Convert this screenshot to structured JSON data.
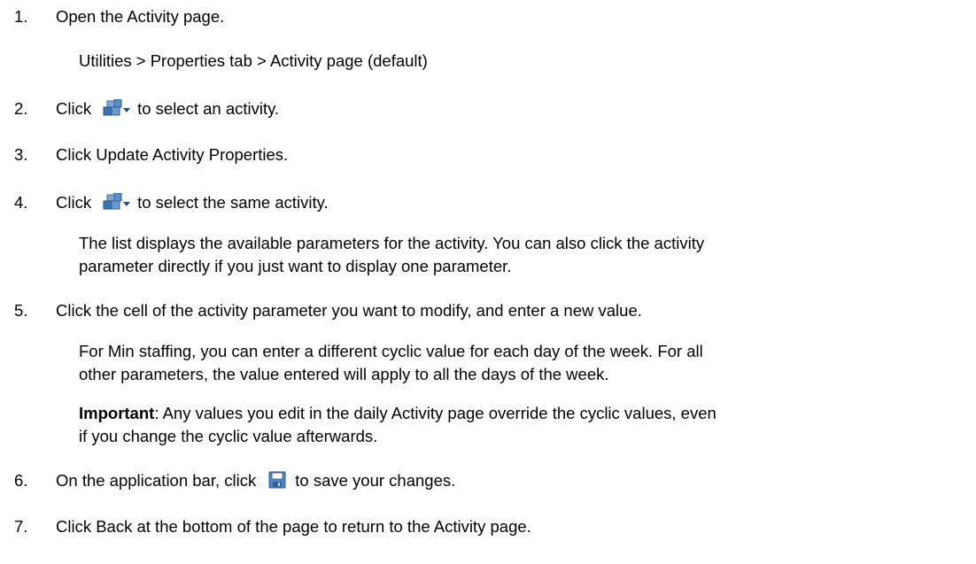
{
  "steps": [
    {
      "num": "1.",
      "text": "Open the Activity page."
    },
    {
      "num": "2.",
      "pre": "Click",
      "post": "to select an activity.",
      "icon": "activity-select-icon"
    },
    {
      "num": "3.",
      "text": "Click Update Activity Properties."
    },
    {
      "num": "4.",
      "pre": "Click",
      "post": "to select the same activity.",
      "icon": "activity-select-icon"
    },
    {
      "num": "5.",
      "text": "Click the cell of the activity parameter you want to modify, and enter a new value."
    },
    {
      "num": "6.",
      "pre": "On the application bar, click",
      "post": "to save your changes.",
      "icon": "save-icon"
    },
    {
      "num": "7.",
      "text": "Click Back at the bottom of the page to return to the Activity page."
    }
  ],
  "notes": {
    "path": "Utilities > Properties tab > Activity page (default)",
    "list_line1": "The list displays the available parameters for the activity. You can also click the activity",
    "list_line2": "parameter directly if you just want to display one parameter.",
    "min_line1": "For Min staffing, you can enter a different cyclic value for each day of the week. For all",
    "min_line2": "other parameters, the value entered will apply to all the days of the week.",
    "important_label": "Important",
    "important_line1": ": Any values you edit in the daily Activity page override the cyclic values, even",
    "important_line2": "if you change the cyclic value afterwards."
  }
}
